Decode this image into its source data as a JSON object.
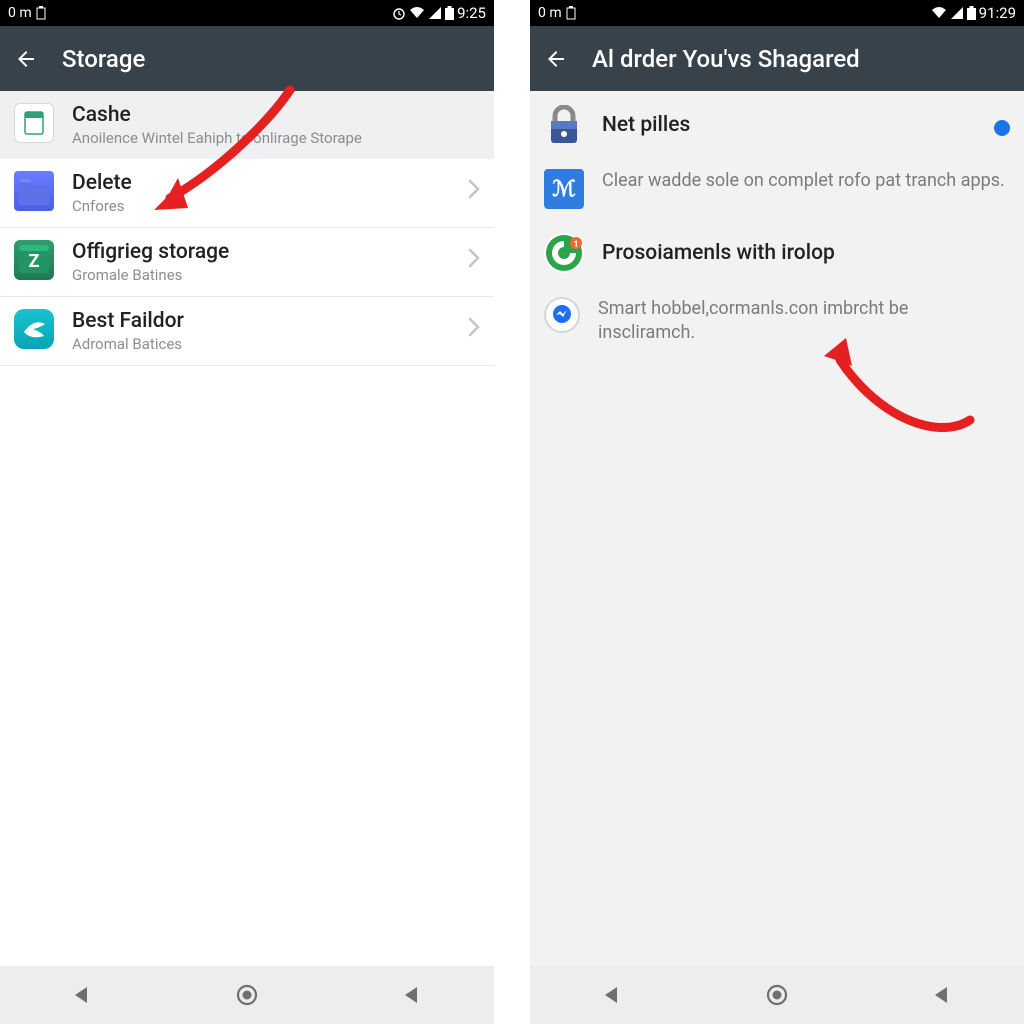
{
  "left": {
    "statusbar": {
      "left": "0 m",
      "clock": "9:25"
    },
    "appbar": {
      "title": "Storage"
    },
    "rows": [
      {
        "icon": "cashe-icon",
        "title": "Cashe",
        "sub": "Anoilence Wintel Eahiph to onlirage Storape"
      },
      {
        "icon": "folder-icon",
        "title": "Delete",
        "sub": "Cnfores"
      },
      {
        "icon": "z-icon",
        "title": "Offigrieg storage",
        "sub": "Gromale Batines"
      },
      {
        "icon": "swift-icon",
        "title": "Best Faildor",
        "sub": "Adromal Batices"
      }
    ]
  },
  "right": {
    "statusbar": {
      "left": "0 m",
      "clock": "91:29"
    },
    "appbar": {
      "title": "Al drder You'vs Shagared"
    },
    "rows": [
      {
        "icon": "lock-icon",
        "title": "Net pilles",
        "toggle": true
      },
      {
        "icon": "m-icon",
        "body": "Clear wadde sole on complet rofo pat tranch apps."
      },
      {
        "icon": "g-icon",
        "title": "Prosoiamenls with irolop"
      },
      {
        "icon": "msg-icon",
        "body": "Smart hobbel,cormanls.con imbrcht be inscliramch."
      }
    ]
  }
}
